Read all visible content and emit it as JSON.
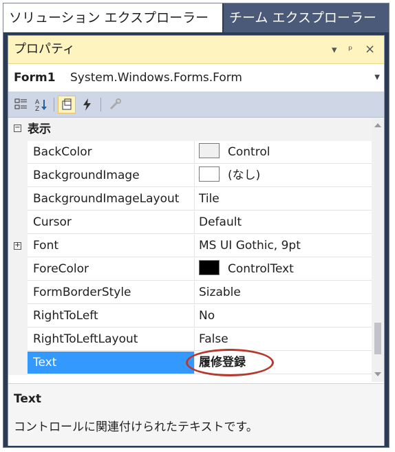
{
  "tabs": [
    {
      "label": "ソリューション エクスプローラー",
      "active": true
    },
    {
      "label": "チーム エクスプローラー",
      "active": false
    }
  ],
  "panel": {
    "title": "プロパティ",
    "dropdown_icon": "dropdown-arrow-icon",
    "pin_icon": "pin-icon",
    "close_icon": "close-icon"
  },
  "object_selector": {
    "name": "Form1",
    "type": "System.Windows.Forms.Form"
  },
  "toolbar": {
    "buttons": [
      "categorized-icon",
      "alphabetical-icon",
      "properties-icon",
      "events-icon",
      "property-pages-icon"
    ],
    "selected": "properties-icon"
  },
  "category": {
    "label": "表示",
    "expander": "⊟"
  },
  "properties": [
    {
      "name": "BackColor",
      "value": "Control",
      "swatch": "#f0f0f0"
    },
    {
      "name": "BackgroundImage",
      "value": "(なし)",
      "swatch": "#ffffff"
    },
    {
      "name": "BackgroundImageLayout",
      "value": "Tile"
    },
    {
      "name": "Cursor",
      "value": "Default"
    },
    {
      "name": "Font",
      "value": "MS UI Gothic, 9pt",
      "expandable": true
    },
    {
      "name": "ForeColor",
      "value": "ControlText",
      "swatch": "#000000"
    },
    {
      "name": "FormBorderStyle",
      "value": "Sizable"
    },
    {
      "name": "RightToLeft",
      "value": "No"
    },
    {
      "name": "RightToLeftLayout",
      "value": "False"
    },
    {
      "name": "Text",
      "value": "履修登録",
      "selected": true
    }
  ],
  "description": {
    "title": "Text",
    "text": "コントロールに関連付けられたテキストです。"
  },
  "colors": {
    "selection": "#3399ff",
    "titlebar": "#fdf4bf",
    "highlight_oval": "#b5392f"
  }
}
